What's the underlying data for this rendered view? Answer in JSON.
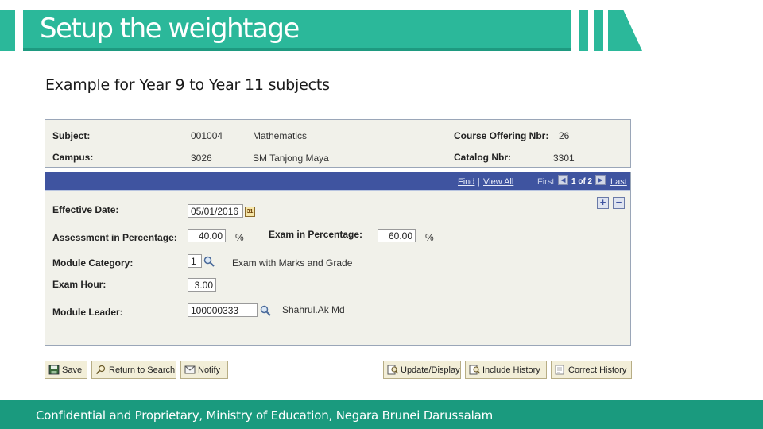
{
  "slide": {
    "title": "Setup the weightage",
    "subtitle": "Example for Year 9 to Year 11 subjects",
    "footer": "Confidential and Proprietary, Ministry of Education, Negara Brunei Darussalam"
  },
  "header": {
    "subject_label": "Subject:",
    "subject_code": "001004",
    "subject_name": "Mathematics",
    "campus_label": "Campus:",
    "campus_code": "3026",
    "campus_name": "SM Tanjong Maya",
    "course_offering_label": "Course Offering Nbr:",
    "course_offering_value": "26",
    "catalog_label": "Catalog Nbr:",
    "catalog_value": "3301"
  },
  "grid_nav": {
    "find": "Find",
    "separator": "|",
    "view_all": "View All",
    "first": "First",
    "position": "1 of 2",
    "last": "Last"
  },
  "form": {
    "effective_date_label": "Effective Date:",
    "effective_date_value": "05/01/2016",
    "calendar_glyph": "31",
    "assessment_label": "Assessment in Percentage:",
    "assessment_value": "40.00",
    "assessment_unit": "%",
    "exam_pct_label": "Exam in Percentage:",
    "exam_pct_value": "60.00",
    "exam_pct_unit": "%",
    "module_category_label": "Module Category:",
    "module_category_value": "1",
    "module_category_desc": "Exam with Marks and Grade",
    "exam_hour_label": "Exam Hour:",
    "exam_hour_value": "3.00",
    "module_leader_label": "Module Leader:",
    "module_leader_value": "100000333",
    "module_leader_name": "Shahrul.Ak Md"
  },
  "buttons": {
    "save": "Save",
    "return_to_search": "Return to Search",
    "notify": "Notify",
    "update_display": "Update/Display",
    "include_history": "Include History",
    "correct_history": "Correct History"
  },
  "colors": {
    "banner": "#2bb89a",
    "footer": "#1a9a7e",
    "grid_bar": "#3f54a0",
    "panel_bg": "#f1f1ea"
  }
}
